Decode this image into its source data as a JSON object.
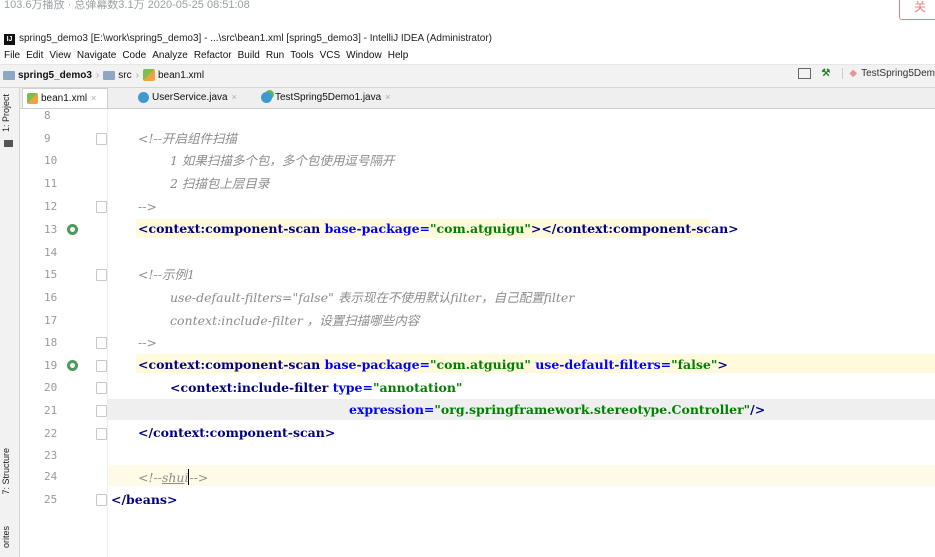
{
  "header_strip": {
    "meta": "103.6万播放 · 总弹幕数3.1万   2020-05-25 08:51:08",
    "follow_label": "关"
  },
  "window": {
    "app_icon": "IJ",
    "title": "spring5_demo3 [E:\\work\\spring5_demo3] - ...\\src\\bean1.xml [spring5_demo3] - IntelliJ IDEA (Administrator)"
  },
  "menu": [
    "File",
    "Edit",
    "View",
    "Navigate",
    "Code",
    "Analyze",
    "Refactor",
    "Build",
    "Run",
    "Tools",
    "VCS",
    "Window",
    "Help"
  ],
  "breadcrumb": {
    "project": "spring5_demo3",
    "folder": "src",
    "file": "bean1.xml"
  },
  "toolbar_right": {
    "run_config": "TestSpring5Dem"
  },
  "side_tools": {
    "project": "1: Project",
    "structure": "7: Structure",
    "favorites": "orites"
  },
  "tabs": [
    {
      "label": "bean1.xml",
      "icon": "xml-file-icon",
      "active": true
    },
    {
      "label": "UserService.java",
      "icon": "java-class-icon",
      "active": false
    },
    {
      "label": "TestSpring5Demo1.java",
      "icon": "java-test-class-icon",
      "active": false
    }
  ],
  "colors": {
    "comment": "#8c8c8c",
    "tag": "#000080",
    "attribute": "#0000ff",
    "value": "#008000",
    "line_number": "#9a9a9a"
  },
  "editor": {
    "line_numbers": [
      "8",
      "9",
      "10",
      "11",
      "12",
      "13",
      "14",
      "15",
      "16",
      "17",
      "18",
      "19",
      "20",
      "21",
      "22",
      "23",
      "24",
      "25"
    ],
    "lines": {
      "l9": "<!--开启组件扫描",
      "l10": "1 如果扫描多个包，多个包使用逗号隔开",
      "l11": "2 扫描包上层目录",
      "l12": "-->",
      "l13": {
        "open": "<context:component-scan ",
        "attr": "base-package=",
        "val": "\"com.atguigu\"",
        "close": "></context:component-scan>"
      },
      "l15": "<!--示例1",
      "l16": "use-default-filters=\"false\" 表示现在不使用默认filter，自己配置filter",
      "l17": "context:include-filter ，设置扫描哪些内容",
      "l18": "-->",
      "l19": {
        "open": "<context:component-scan ",
        "attr1": "base-package=",
        "val1": "\"com.atguigu\" ",
        "attr2": "use-default-filters=",
        "val2": "\"false\"",
        "close": ">"
      },
      "l20": {
        "open": "<context:include-filter ",
        "attr": "type=",
        "val": "\"annotation\""
      },
      "l21": {
        "attr": "expression=",
        "val": "\"org.springframework.stereotype.Controller\"",
        "close": "/>"
      },
      "l22": "</context:component-scan>",
      "l24": {
        "open": "<!--",
        "word": "shu",
        "tail": "i",
        "close": "-->"
      },
      "l25": "</beans>"
    }
  }
}
